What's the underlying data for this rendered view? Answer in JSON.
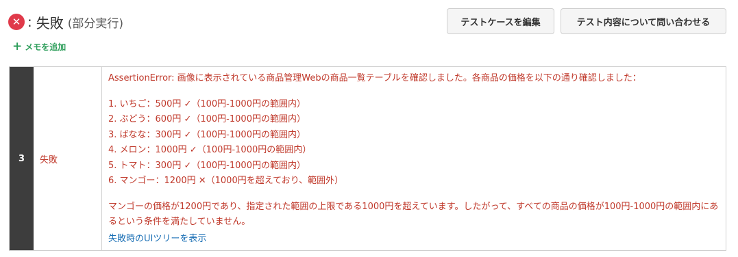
{
  "status": {
    "colon": ":",
    "label": "失敗",
    "sub": "(部分実行)",
    "icon": "close-circle-icon",
    "icon_glyph": "✕",
    "color": "#e03a4a"
  },
  "buttons": {
    "edit_label": "テストケースを編集",
    "inquire_label": "テスト内容について問い合わせる"
  },
  "memo": {
    "icon_glyph": "+",
    "label": "メモを追加",
    "color": "#2e9e5b"
  },
  "step": {
    "number": "3",
    "result": "失敗",
    "intro": "AssertionError: 画像に表示されている商品管理Webの商品一覧テーブルを確認しました。各商品の価格を以下の通り確認しました：",
    "items": [
      "1. いちご：500円 ✓（100円-1000円の範囲内）",
      "2. ぶどう：600円 ✓（100円-1000円の範囲内）",
      "3. ばなな：300円 ✓（100円-1000円の範囲内）",
      "4. メロン：1000円 ✓（100円-1000円の範囲内）",
      "5. トマト：300円 ✓（100円-1000円の範囲内）",
      "6. マンゴー：1200円 ✕（1000円を超えており、範囲外）"
    ],
    "conclusion": "マンゴーの価格が1200円であり、指定された範囲の上限である1000円を超えています。したがって、すべての商品の価格が100円-1000円の範囲内にあるという条件を満たしていません。",
    "link_label": "失敗時のUIツリーを表示",
    "error_color": "#c0392b",
    "link_color": "#1a6fb5"
  }
}
